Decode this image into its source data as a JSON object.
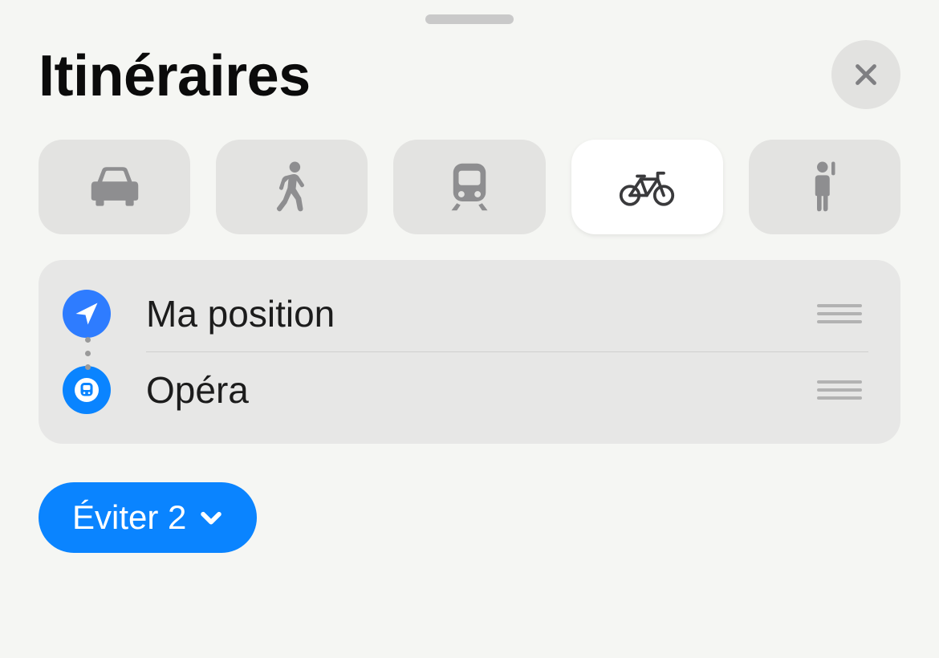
{
  "header": {
    "title": "Itinéraires"
  },
  "modes": [
    {
      "id": "car",
      "icon": "car-icon"
    },
    {
      "id": "walk",
      "icon": "walk-icon"
    },
    {
      "id": "transit",
      "icon": "transit-icon"
    },
    {
      "id": "bike",
      "icon": "bike-icon",
      "active": true
    },
    {
      "id": "ride",
      "icon": "rideshare-icon"
    }
  ],
  "route": {
    "from": {
      "label": "Ma position",
      "icon": "location-icon",
      "icon_bg": "#2e7cff"
    },
    "to": {
      "label": "Opéra",
      "icon": "metro-icon",
      "icon_bg": "#0a84ff"
    }
  },
  "options": {
    "avoid_label": "Éviter 2"
  },
  "colors": {
    "accent": "#0a84ff",
    "icon_gray": "#8e8e90",
    "icon_dark": "#3a3a3c"
  }
}
